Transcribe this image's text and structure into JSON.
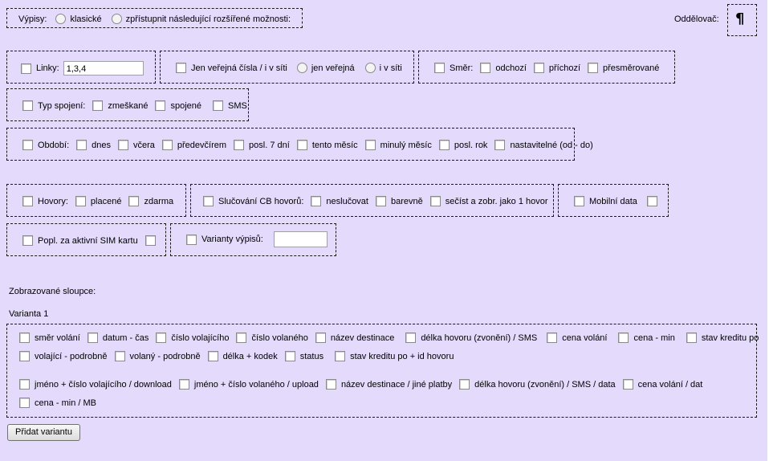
{
  "vypisy": {
    "label": "Výpisy:",
    "opt1": "klasické",
    "opt2": "zpřístupnit následující rozšířené možnosti:"
  },
  "oddelovac": {
    "label": "Oddělovač:",
    "symbol": "¶"
  },
  "linky": {
    "label": "Linky:",
    "value": "1,3,4"
  },
  "verejna": {
    "label": "Jen veřejná čísla / i v síti",
    "opt1": "jen veřejná",
    "opt2": "i v síti"
  },
  "smer": {
    "label": "Směr:",
    "items": [
      "odchozí",
      "příchozí",
      "přesměrované"
    ]
  },
  "typ": {
    "label": "Typ spojení:",
    "items": [
      "zmeškané",
      "spojené",
      "SMS"
    ]
  },
  "obdobi": {
    "label": "Období:",
    "items": [
      "dnes",
      "včera",
      "předevčírem",
      "posl. 7 dní",
      "tento měsíc",
      "minulý měsíc",
      "posl. rok",
      "nastavitelné (od - do)"
    ]
  },
  "hovory": {
    "label": "Hovory:",
    "items": [
      "placené",
      "zdarma"
    ]
  },
  "slucovani": {
    "label": "Slučování CB hovorů:",
    "items": [
      "neslučovat",
      "barevně",
      "sečíst a zobr. jako 1 hovor"
    ]
  },
  "mobilni": {
    "label": "Mobilní data"
  },
  "popl": {
    "label": "Popl. za aktivní SIM kartu"
  },
  "varianty": {
    "label": "Varianty výpisů:",
    "value": ""
  },
  "sloupce": {
    "title": "Zobrazované sloupce:",
    "variant": "Varianta 1",
    "row1": [
      "směr volání",
      "datum - čas",
      "číslo volajícího",
      "číslo volaného",
      "název destinace",
      "délka hovoru (zvonění) / SMS",
      "cena volání",
      "cena - min",
      "stav kreditu po"
    ],
    "row2": [
      "volající - podrobně",
      "volaný - podrobně",
      "délka + kodek",
      "status",
      "stav kreditu po + id hovoru"
    ],
    "row3": [
      "jméno + číslo volajícího / download",
      "jméno + číslo volaného / upload",
      "název destinace / jiné platby",
      "délka hovoru (zvonění) / SMS / data",
      "cena volání / dat"
    ],
    "row4": [
      "cena - min / MB"
    ]
  },
  "add_button": "Přidat variantu"
}
